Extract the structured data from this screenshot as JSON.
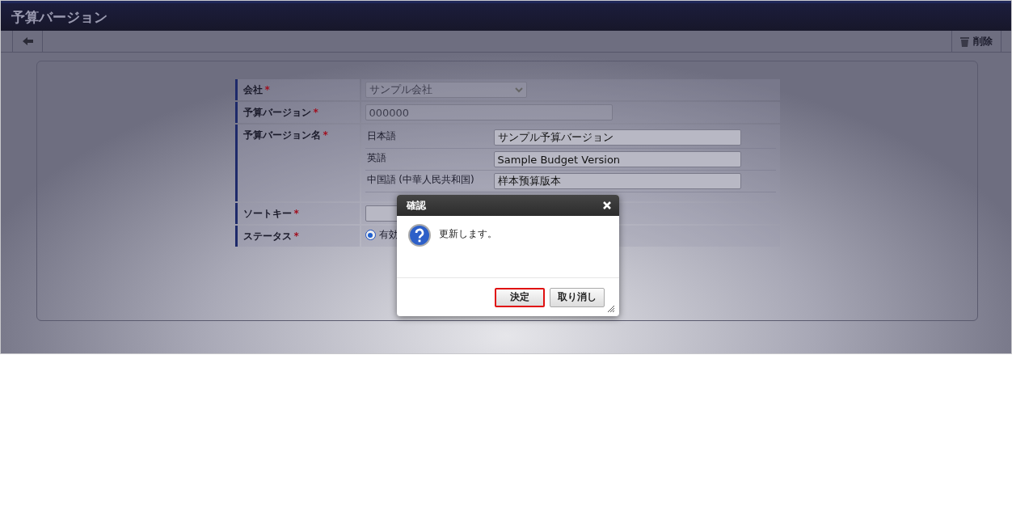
{
  "title": "予算バージョン",
  "toolbar": {
    "back_button": {
      "kind": "back"
    },
    "delete_button": {
      "label": "削除"
    }
  },
  "form": {
    "rows": [
      {
        "kind": "select",
        "label": "会社",
        "required_mark": "*",
        "value": "サンプル会社",
        "disabled": true
      },
      {
        "kind": "text",
        "label": "予算バージョン",
        "required_mark": "*",
        "value": "000000",
        "disabled": true
      },
      {
        "kind": "locales",
        "label": "予算バージョン名",
        "required_mark": "*",
        "locales": [
          {
            "label": "日本語",
            "value": "サンプル予算バージョン"
          },
          {
            "label": "英語",
            "value": "Sample Budget Version"
          },
          {
            "label": "中国語 (中華人民共和国)",
            "value": "样本预算版本"
          }
        ]
      },
      {
        "kind": "text",
        "label": "ソートキー",
        "required_mark": "*",
        "value": "",
        "disabled": false
      },
      {
        "kind": "radio",
        "label": "ステータス",
        "required_mark": "*",
        "options": [
          {
            "label": "有効",
            "selected": true
          }
        ]
      }
    ]
  },
  "dialog": {
    "title": "確認",
    "message": "更新します。",
    "buttons": [
      {
        "label": "決定",
        "focused": true
      },
      {
        "label": "取り消し",
        "focused": false
      }
    ]
  }
}
